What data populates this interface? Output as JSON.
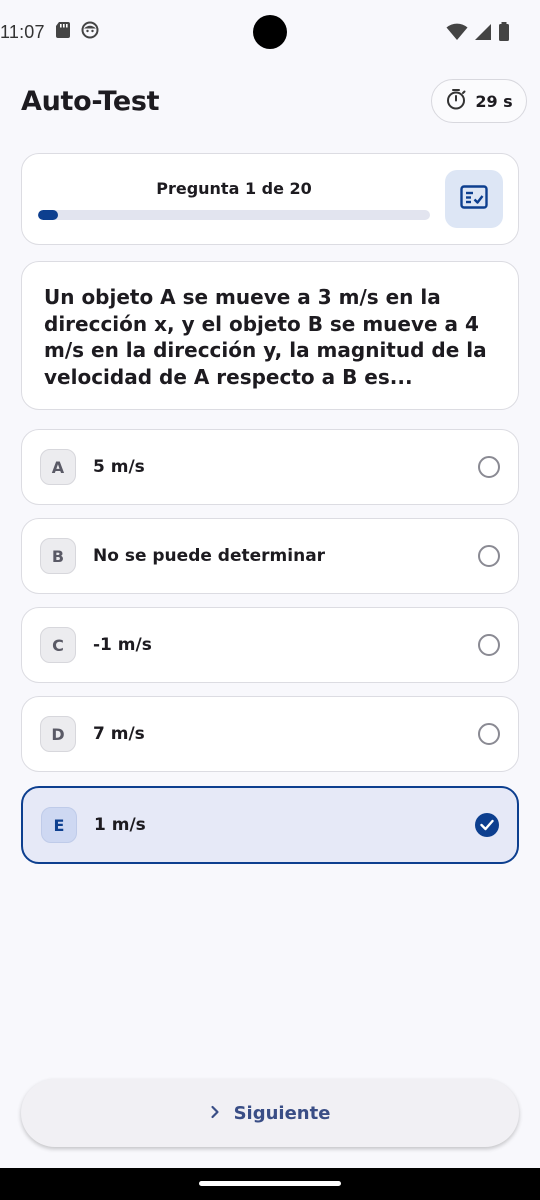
{
  "status_bar": {
    "time": "11:07",
    "left_icons": [
      "sd-card-icon",
      "face-icon"
    ],
    "right_icons": [
      "wifi-icon",
      "signal-icon",
      "battery-icon"
    ]
  },
  "header": {
    "title": "Auto-Test",
    "timer": "29 s",
    "timer_icon": "stopwatch-icon"
  },
  "progress": {
    "label": "Pregunta 1 de 20",
    "current": 1,
    "total": 20,
    "fraction": 0.05,
    "summary_icon": "checklist-icon"
  },
  "question": {
    "text": "Un objeto A se mueve a 3 m/s en la dirección x, y el objeto B se mueve a 4 m/s en la dirección y, la magnitud de la velocidad de A respecto a B es..."
  },
  "options": [
    {
      "letter": "A",
      "label": "5 m/s",
      "selected": false
    },
    {
      "letter": "B",
      "label": "No se puede determinar",
      "selected": false
    },
    {
      "letter": "C",
      "label": "-1 m/s",
      "selected": false
    },
    {
      "letter": "D",
      "label": "7 m/s",
      "selected": false
    },
    {
      "letter": "E",
      "label": "1 m/s",
      "selected": true
    }
  ],
  "footer": {
    "next_label": "Siguiente",
    "next_icon": "chevron-right-icon"
  },
  "colors": {
    "primary": "#0d3f8f",
    "selected_bg": "#e6e9f7",
    "background": "#f8f8fc"
  }
}
